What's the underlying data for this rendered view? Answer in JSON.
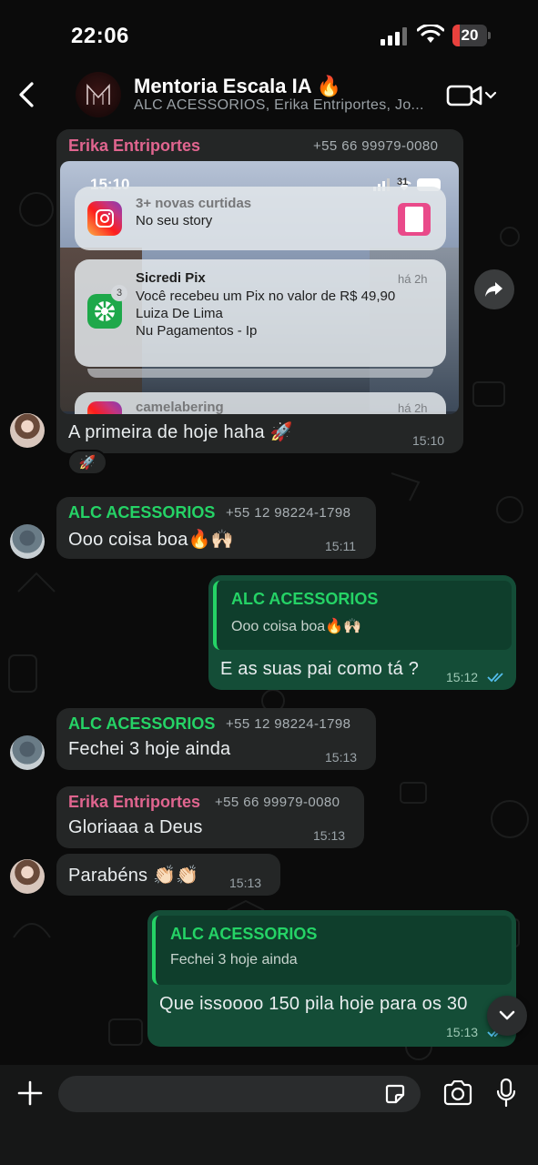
{
  "status_bar": {
    "time": "22:06",
    "battery": "20",
    "battery_level": 0.2
  },
  "header": {
    "title": "Mentoria Escala IA 🔥",
    "subtitle": "ALC ACESSORIOS, Erika Entriportes, Jo...",
    "avatar_letter": "M"
  },
  "colors": {
    "accent_green": "#25d366",
    "erika_name": "#e0658f",
    "alc_name": "#25d366",
    "incoming_bubble": "#242626",
    "outgoing_bubble": "#144d37",
    "read_ticks": "#53bdeb"
  },
  "screenshot": {
    "time": "15:10",
    "battery": "31",
    "notif1": {
      "title": "3+ novas curtidas",
      "line1": "No seu story"
    },
    "notif2": {
      "title": "Sicredi Pix",
      "ago": "há 2h",
      "badge": "3",
      "line1": "Você recebeu um Pix no valor de R$ 49,90",
      "line2": "Luiza De Lima",
      "line3": "Nu Pagamentos - Ip"
    },
    "notif3": {
      "title": "camelabering",
      "ago": "há 2h"
    }
  },
  "messages": [
    {
      "sender": "Erika Entriportes",
      "phone": "+55 66 99979-0080",
      "text": "A primeira de hoje haha 🚀",
      "time": "15:10",
      "reaction": "🚀"
    },
    {
      "sender": "ALC ACESSORIOS",
      "phone": "+55 12 98224-1798",
      "text": "Ooo coisa boa🔥🙌🏻",
      "time": "15:11"
    },
    {
      "quote_name": "ALC ACESSORIOS",
      "quote_text": "Ooo coisa boa🔥🙌🏻",
      "text": "E as suas pai como tá ?",
      "time": "15:12"
    },
    {
      "sender": "ALC ACESSORIOS",
      "phone": "+55 12 98224-1798",
      "text": "Fechei 3 hoje ainda",
      "time": "15:13"
    },
    {
      "sender": "Erika Entriportes",
      "phone": "+55 66 99979-0080",
      "text": "Gloriaaa a Deus",
      "time": "15:13"
    },
    {
      "text": "Parabéns 👏🏻👏🏻",
      "time": "15:13"
    },
    {
      "quote_name": "ALC ACESSORIOS",
      "quote_text": "Fechei 3 hoje ainda",
      "text": "Que issoooo 150 pila hoje para os 30",
      "time": "15:13"
    }
  ],
  "icons": {
    "back": "chevron-left-icon",
    "video": "video-camera-icon",
    "forward": "forward-arrow-icon",
    "scroll_down": "chevron-down-icon",
    "attach": "plus-icon",
    "sticker": "sticker-icon",
    "camera": "camera-icon",
    "mic": "microphone-icon"
  }
}
